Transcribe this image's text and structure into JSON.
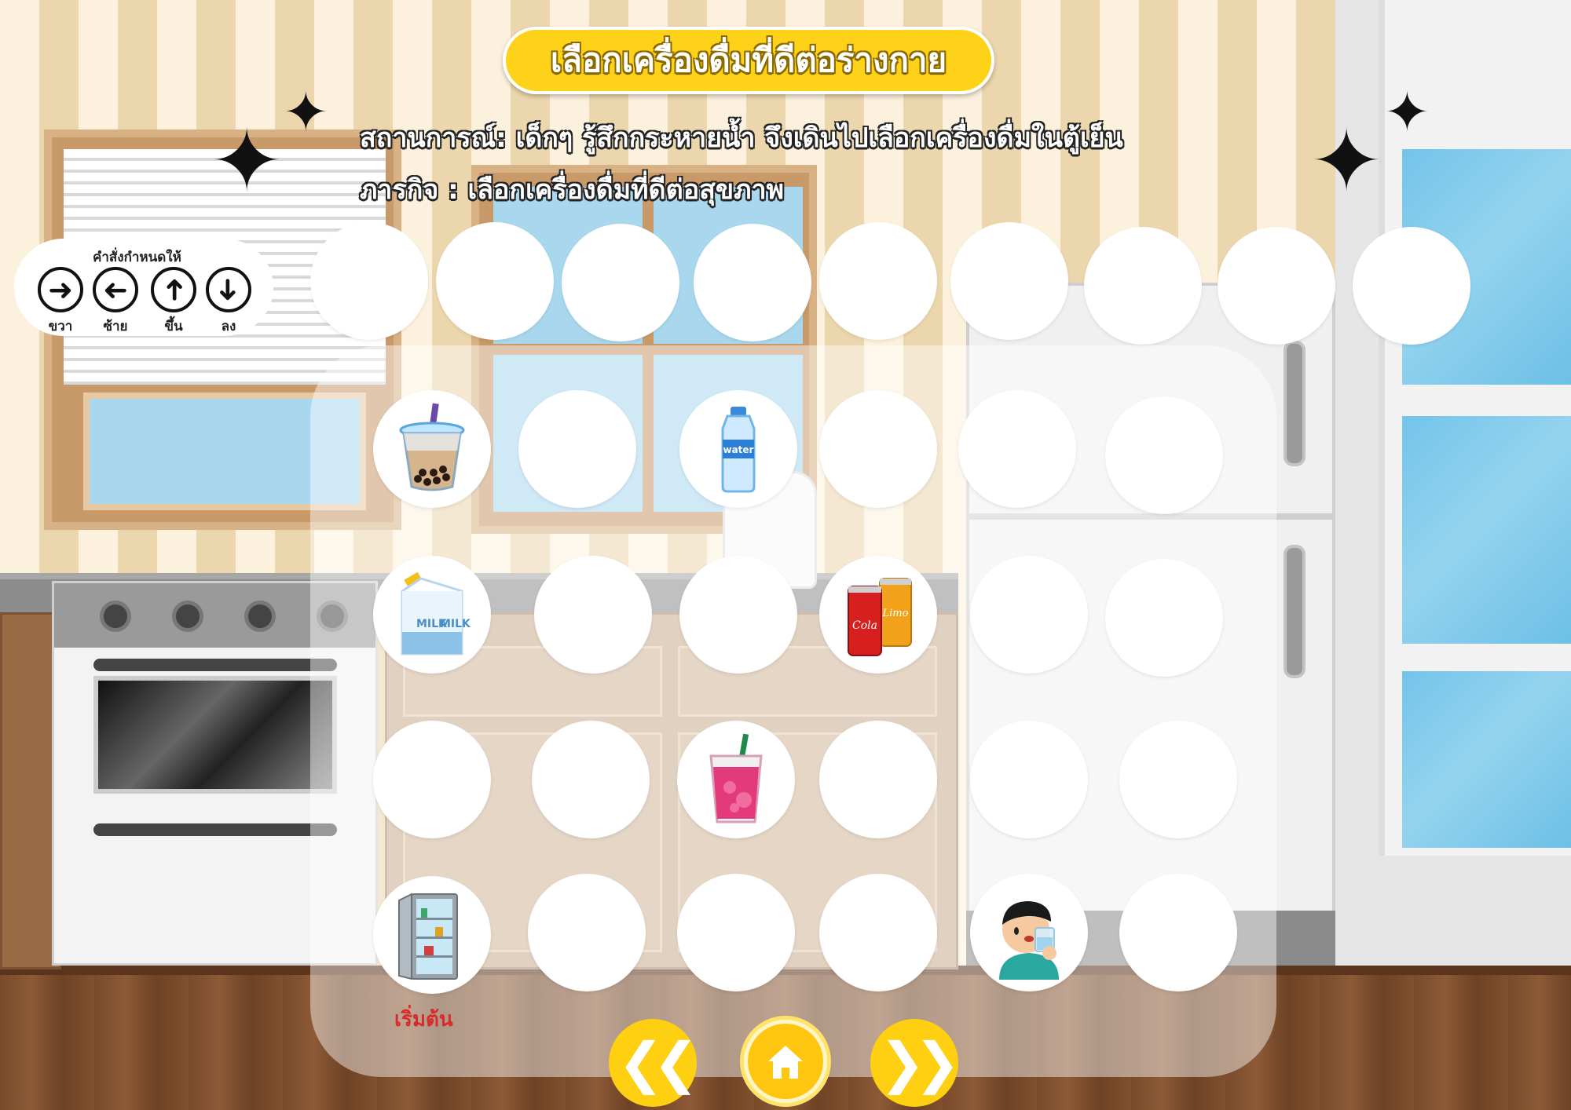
{
  "title": "เลือกเครื่องดื่มที่ดีต่อร่างกาย",
  "scenario": {
    "situation": "สถานการณ์: เด็กๆ รู้สึกกระหายน้ำ จึงเดินไปเลือกเครื่องดื่มในตู้เย็น",
    "mission": "ภารกิจ : เลือกเครื่องดื่มที่ดีต่อสุขภาพ"
  },
  "command_legend": {
    "title": "คำสั่งกำหนดให้",
    "commands": [
      {
        "label": "ขวา",
        "icon": "arrow-right-icon"
      },
      {
        "label": "ซ้าย",
        "icon": "arrow-left-icon"
      },
      {
        "label": "ขึ้น",
        "icon": "arrow-up-icon"
      },
      {
        "label": "ลง",
        "icon": "arrow-down-icon"
      }
    ]
  },
  "answer_slots_count": 9,
  "board": {
    "start_label": "เริ่มต้น",
    "items": {
      "bubble_tea": {
        "row": 1,
        "col": 1,
        "icon": "bubble-tea-icon"
      },
      "water": {
        "row": 1,
        "col": 3,
        "icon": "water-bottle-icon",
        "text": "water"
      },
      "milk": {
        "row": 2,
        "col": 1,
        "icon": "milk-carton-icon",
        "text": "MILK"
      },
      "soda": {
        "row": 2,
        "col": 4,
        "icon": "soda-cans-icon",
        "text_a": "Cola",
        "text_b": "Limo"
      },
      "pink_drink": {
        "row": 3,
        "col": 3,
        "icon": "pink-drink-icon"
      },
      "fridge": {
        "row": 4,
        "col": 1,
        "icon": "fridge-icon"
      },
      "boy": {
        "row": 4,
        "col": 5,
        "icon": "boy-drinking-icon"
      }
    }
  },
  "nav": {
    "prev_icon": "double-chevron-left-icon",
    "home_icon": "home-icon",
    "next_icon": "double-chevron-right-icon"
  },
  "colors": {
    "accent": "#ffd21a",
    "start_label": "#d82c2c"
  }
}
